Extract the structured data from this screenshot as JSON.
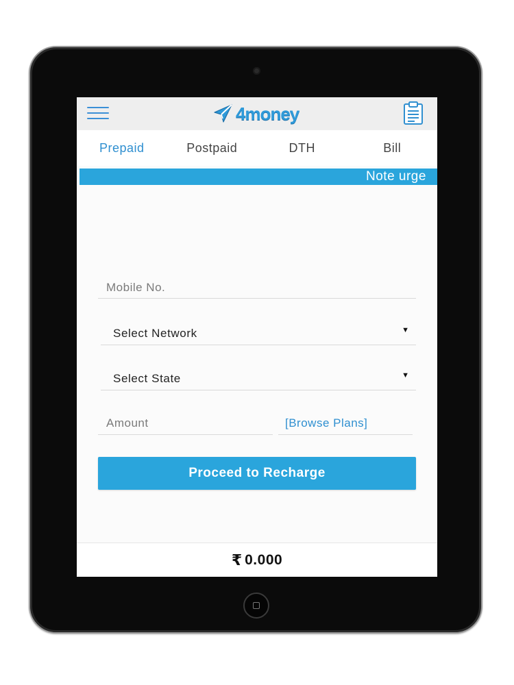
{
  "header": {
    "brand": "4money",
    "menu_icon": "hamburger-menu-icon",
    "logo_icon": "paper-plane-icon",
    "history_icon": "clipboard-icon",
    "accent_color": "#2aa5dc"
  },
  "tabs": [
    {
      "label": "Prepaid",
      "active": true
    },
    {
      "label": "Postpaid",
      "active": false
    },
    {
      "label": "DTH",
      "active": false
    },
    {
      "label": "Bill",
      "active": false
    }
  ],
  "ticker": {
    "text": "Note urge"
  },
  "form": {
    "mobile_placeholder": "Mobile No.",
    "network_label": "Select Network",
    "state_label": "Select State",
    "amount_placeholder": "Amount",
    "browse_plans_label": "[Browse Plans]",
    "dropdown_icon": "caret-down-icon",
    "submit_label": "Proceed to Recharge"
  },
  "footer": {
    "currency_symbol": "₹",
    "balance": "0.000"
  }
}
